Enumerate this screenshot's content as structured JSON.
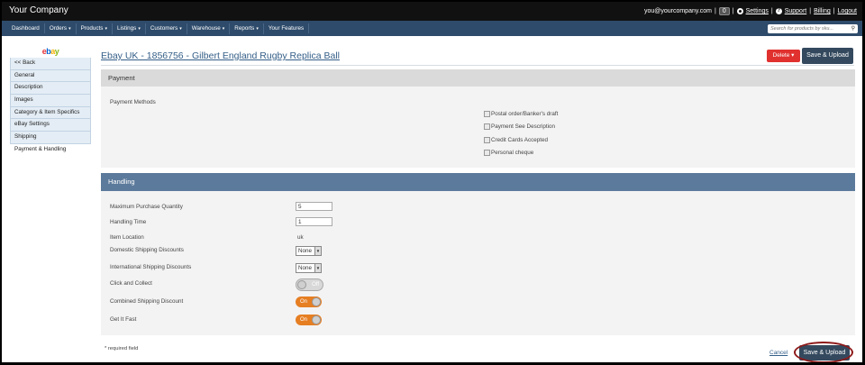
{
  "header": {
    "brand": "Your Company",
    "email": "you@yourcompany.com",
    "badge": "0",
    "settings": "Settings",
    "support": "Support",
    "billing": "Billing",
    "logout": "Logout",
    "pipe": "|"
  },
  "nav": {
    "items": [
      {
        "label": "Dashboard",
        "dropdown": false
      },
      {
        "label": "Orders",
        "dropdown": true
      },
      {
        "label": "Products",
        "dropdown": true
      },
      {
        "label": "Listings",
        "dropdown": true
      },
      {
        "label": "Customers",
        "dropdown": true
      },
      {
        "label": "Warehouse",
        "dropdown": true
      },
      {
        "label": "Reports",
        "dropdown": true
      },
      {
        "label": "Your Features",
        "dropdown": false
      }
    ],
    "search_placeholder": "Search for products by sku..."
  },
  "sidebar": {
    "logo": [
      "e",
      "b",
      "a",
      "y"
    ],
    "items": [
      {
        "label": "<< Back"
      },
      {
        "label": "General"
      },
      {
        "label": "Description"
      },
      {
        "label": "Images"
      },
      {
        "label": "Category & Item Specifics"
      },
      {
        "label": "eBay Settings"
      },
      {
        "label": "Shipping"
      },
      {
        "label": "Payment & Handling",
        "active": true
      }
    ]
  },
  "page": {
    "title": "Ebay UK - 1856756 - Gilbert England Rugby Replica Ball",
    "delete_label": "Delete",
    "save_label": "Save & Upload"
  },
  "payment": {
    "header": "Payment",
    "methods_label": "Payment Methods",
    "methods": [
      {
        "label": "Postal order/Banker's draft",
        "checked": false
      },
      {
        "label": "Payment See Description",
        "checked": false
      },
      {
        "label": "Credit Cards Accepted",
        "checked": false
      },
      {
        "label": "Personal cheque",
        "checked": false
      }
    ]
  },
  "handling": {
    "header": "Handling",
    "max_qty_label": "Maximum Purchase Quantity",
    "max_qty_value": "5",
    "handling_time_label": "Handling Time",
    "handling_time_value": "1",
    "item_location_label": "Item Location",
    "item_location_value": "uk",
    "domestic_label": "Domestic Shipping Discounts",
    "domestic_value": "None",
    "international_label": "International Shipping Discounts",
    "international_value": "None",
    "click_collect_label": "Click and Collect",
    "click_collect_state": "Off",
    "combined_label": "Combined Shipping Discount",
    "combined_state": "On",
    "get_it_fast_label": "Get It Fast",
    "get_it_fast_state": "On"
  },
  "footer": {
    "required_note": "* required field",
    "cancel_label": "Cancel",
    "save_label": "Save & Upload"
  },
  "colors": {
    "topbar": "#111111",
    "navbar": "#2e4b6b",
    "delete": "#e0312f",
    "save": "#34495e",
    "toggle_on": "#e67e22"
  }
}
